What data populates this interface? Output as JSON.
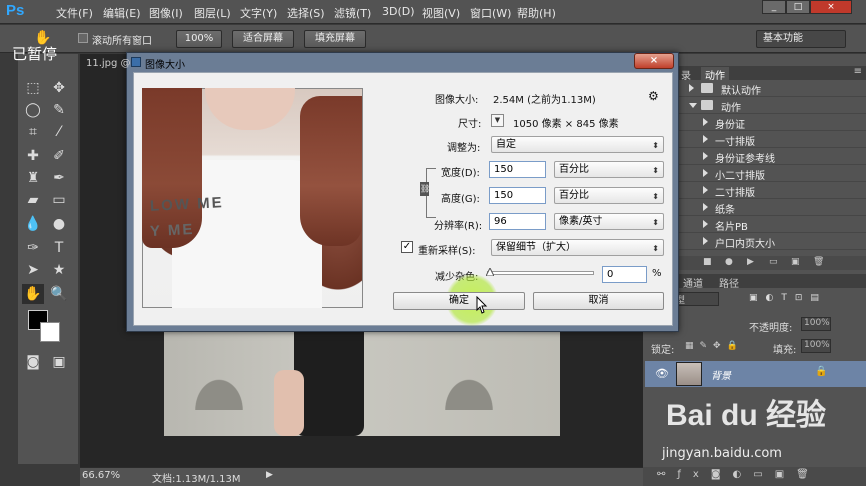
{
  "app": {
    "logo": "Ps",
    "menu": [
      "文件(F)",
      "编辑(E)",
      "图像(I)",
      "图层(L)",
      "文字(Y)",
      "选择(S)",
      "滤镜(T)",
      "3D(D)",
      "视图(V)",
      "窗口(W)",
      "帮助(H)"
    ],
    "window_controls": [
      "_",
      "□",
      "×"
    ]
  },
  "options_bar": {
    "scroll_all_label": "滚动所有窗口",
    "btn_100": "100%",
    "btn_fit": "适合屏幕",
    "btn_fill": "填充屏幕",
    "workspace": "基本功能"
  },
  "overlay": {
    "paused": "已暂停"
  },
  "document": {
    "tab": "11.jpg @",
    "zoom": "66.67%",
    "status": "文档:1.13M/1.13M"
  },
  "dialog": {
    "title": "图像大小",
    "close": "×",
    "image_size_label": "图像大小:",
    "image_size_value": "2.54M (之前为1.13M)",
    "dims_label": "尺寸:",
    "dims_value": "1050 像素  ×  845 像素",
    "fit_label": "调整为:",
    "fit_value": "自定",
    "width_label": "宽度(D):",
    "width_value": "150",
    "width_unit": "百分比",
    "height_label": "高度(G):",
    "height_value": "150",
    "height_unit": "百分比",
    "resolution_label": "分辨率(R):",
    "resolution_value": "96",
    "resolution_unit": "像素/英寸",
    "resample_label": "重新采样(S):",
    "resample_checked": true,
    "resample_value": "保留细节（扩大）",
    "noise_label": "减少杂色:",
    "noise_value": "0",
    "noise_unit": "%",
    "ok": "确定",
    "cancel": "取消",
    "preview_text_1": "LOW ME",
    "preview_text_2": "Y ME"
  },
  "actions_panel": {
    "tabs": [
      "录",
      "动作"
    ],
    "set_name": "默认动作",
    "folder_name": "动作",
    "items": [
      "身份证",
      "一寸排版",
      "身份证参考线",
      "小二寸排版",
      "二寸排版",
      "纸条",
      "名片PB",
      "户口内页大小"
    ]
  },
  "layers_panel": {
    "tabs": [
      "通道",
      "路径"
    ],
    "kind": "型",
    "opacity_label": "不透明度:",
    "opacity_value": "100%",
    "lock_label": "锁定:",
    "fill_label": "填充:",
    "fill_value": "100%",
    "layer_name": "背景"
  },
  "watermark": {
    "brand": "Bai du 经验",
    "url": "jingyan.baidu.com"
  },
  "colors": {
    "accent": "#31a8ff",
    "dialog_frame": "#6b7d95",
    "layer_selected": "#6d84a6",
    "cursor_highlight": "#b4e63c"
  }
}
